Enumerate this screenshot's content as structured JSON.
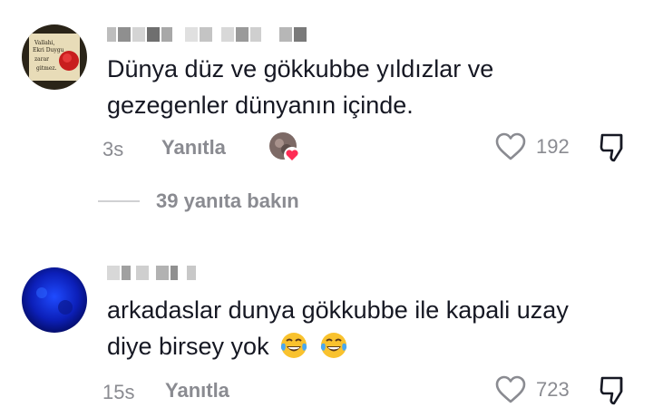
{
  "comments": [
    {
      "text_line1": "Dünya düz ve gökkubbe yıldızlar ve",
      "text_line2": "gezegenler dünyanın içinde.",
      "time": "3s",
      "reply_label": "Yanıtla",
      "likes": "192",
      "view_replies": "39 yanıta bakın",
      "avatar_text": [
        "Vallahi,",
        "Ekri Duygu",
        "zarar",
        "gitmez."
      ]
    },
    {
      "text_line1": "arkadaslar dunya gökkubbe ile kapali uzay",
      "text_line2": "diye birsey yok",
      "time": "15s",
      "reply_label": "Yanıtla",
      "likes": "723"
    }
  ],
  "colors": {
    "text": "#161823",
    "muted": "#8a8b91",
    "heart_badge": "#fe2c55"
  },
  "icons": [
    "heart-outline-icon",
    "dislike-icon",
    "laughing-tears-emoji"
  ]
}
